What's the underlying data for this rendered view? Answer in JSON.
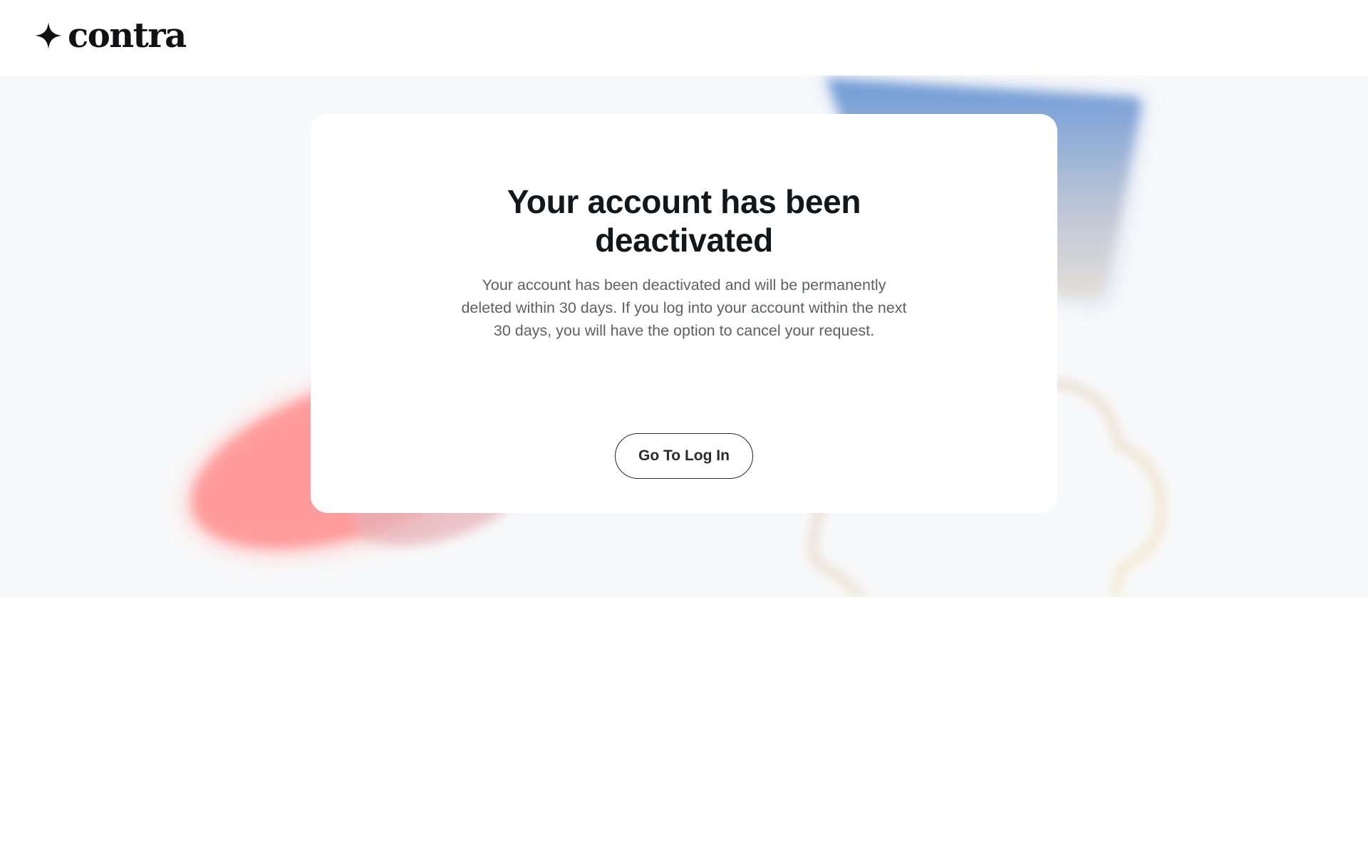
{
  "header": {
    "logo": {
      "icon": "four-point-star-icon",
      "text": "contra"
    }
  },
  "card": {
    "title_lines": [
      "Your account has been",
      "deactivated"
    ],
    "description_lines": [
      "Your account has been deactivated and will be permanently",
      "deleted within 30 days. If you log into your account within the next",
      "30 days, you will have the option to cancel your request."
    ],
    "button_label": "Go To Log In"
  },
  "colors": {
    "page_background": "#ffffff",
    "hero_background": "#f8f9fa",
    "card_background": "#ffffff",
    "title_text": "#15161b",
    "body_text": "#5f6066",
    "button_border": "#2a2b30",
    "deco_red": "#ff9b9b",
    "deco_blue": "#7aa5dd",
    "deco_cloud_outline": "#d9b8a8"
  }
}
